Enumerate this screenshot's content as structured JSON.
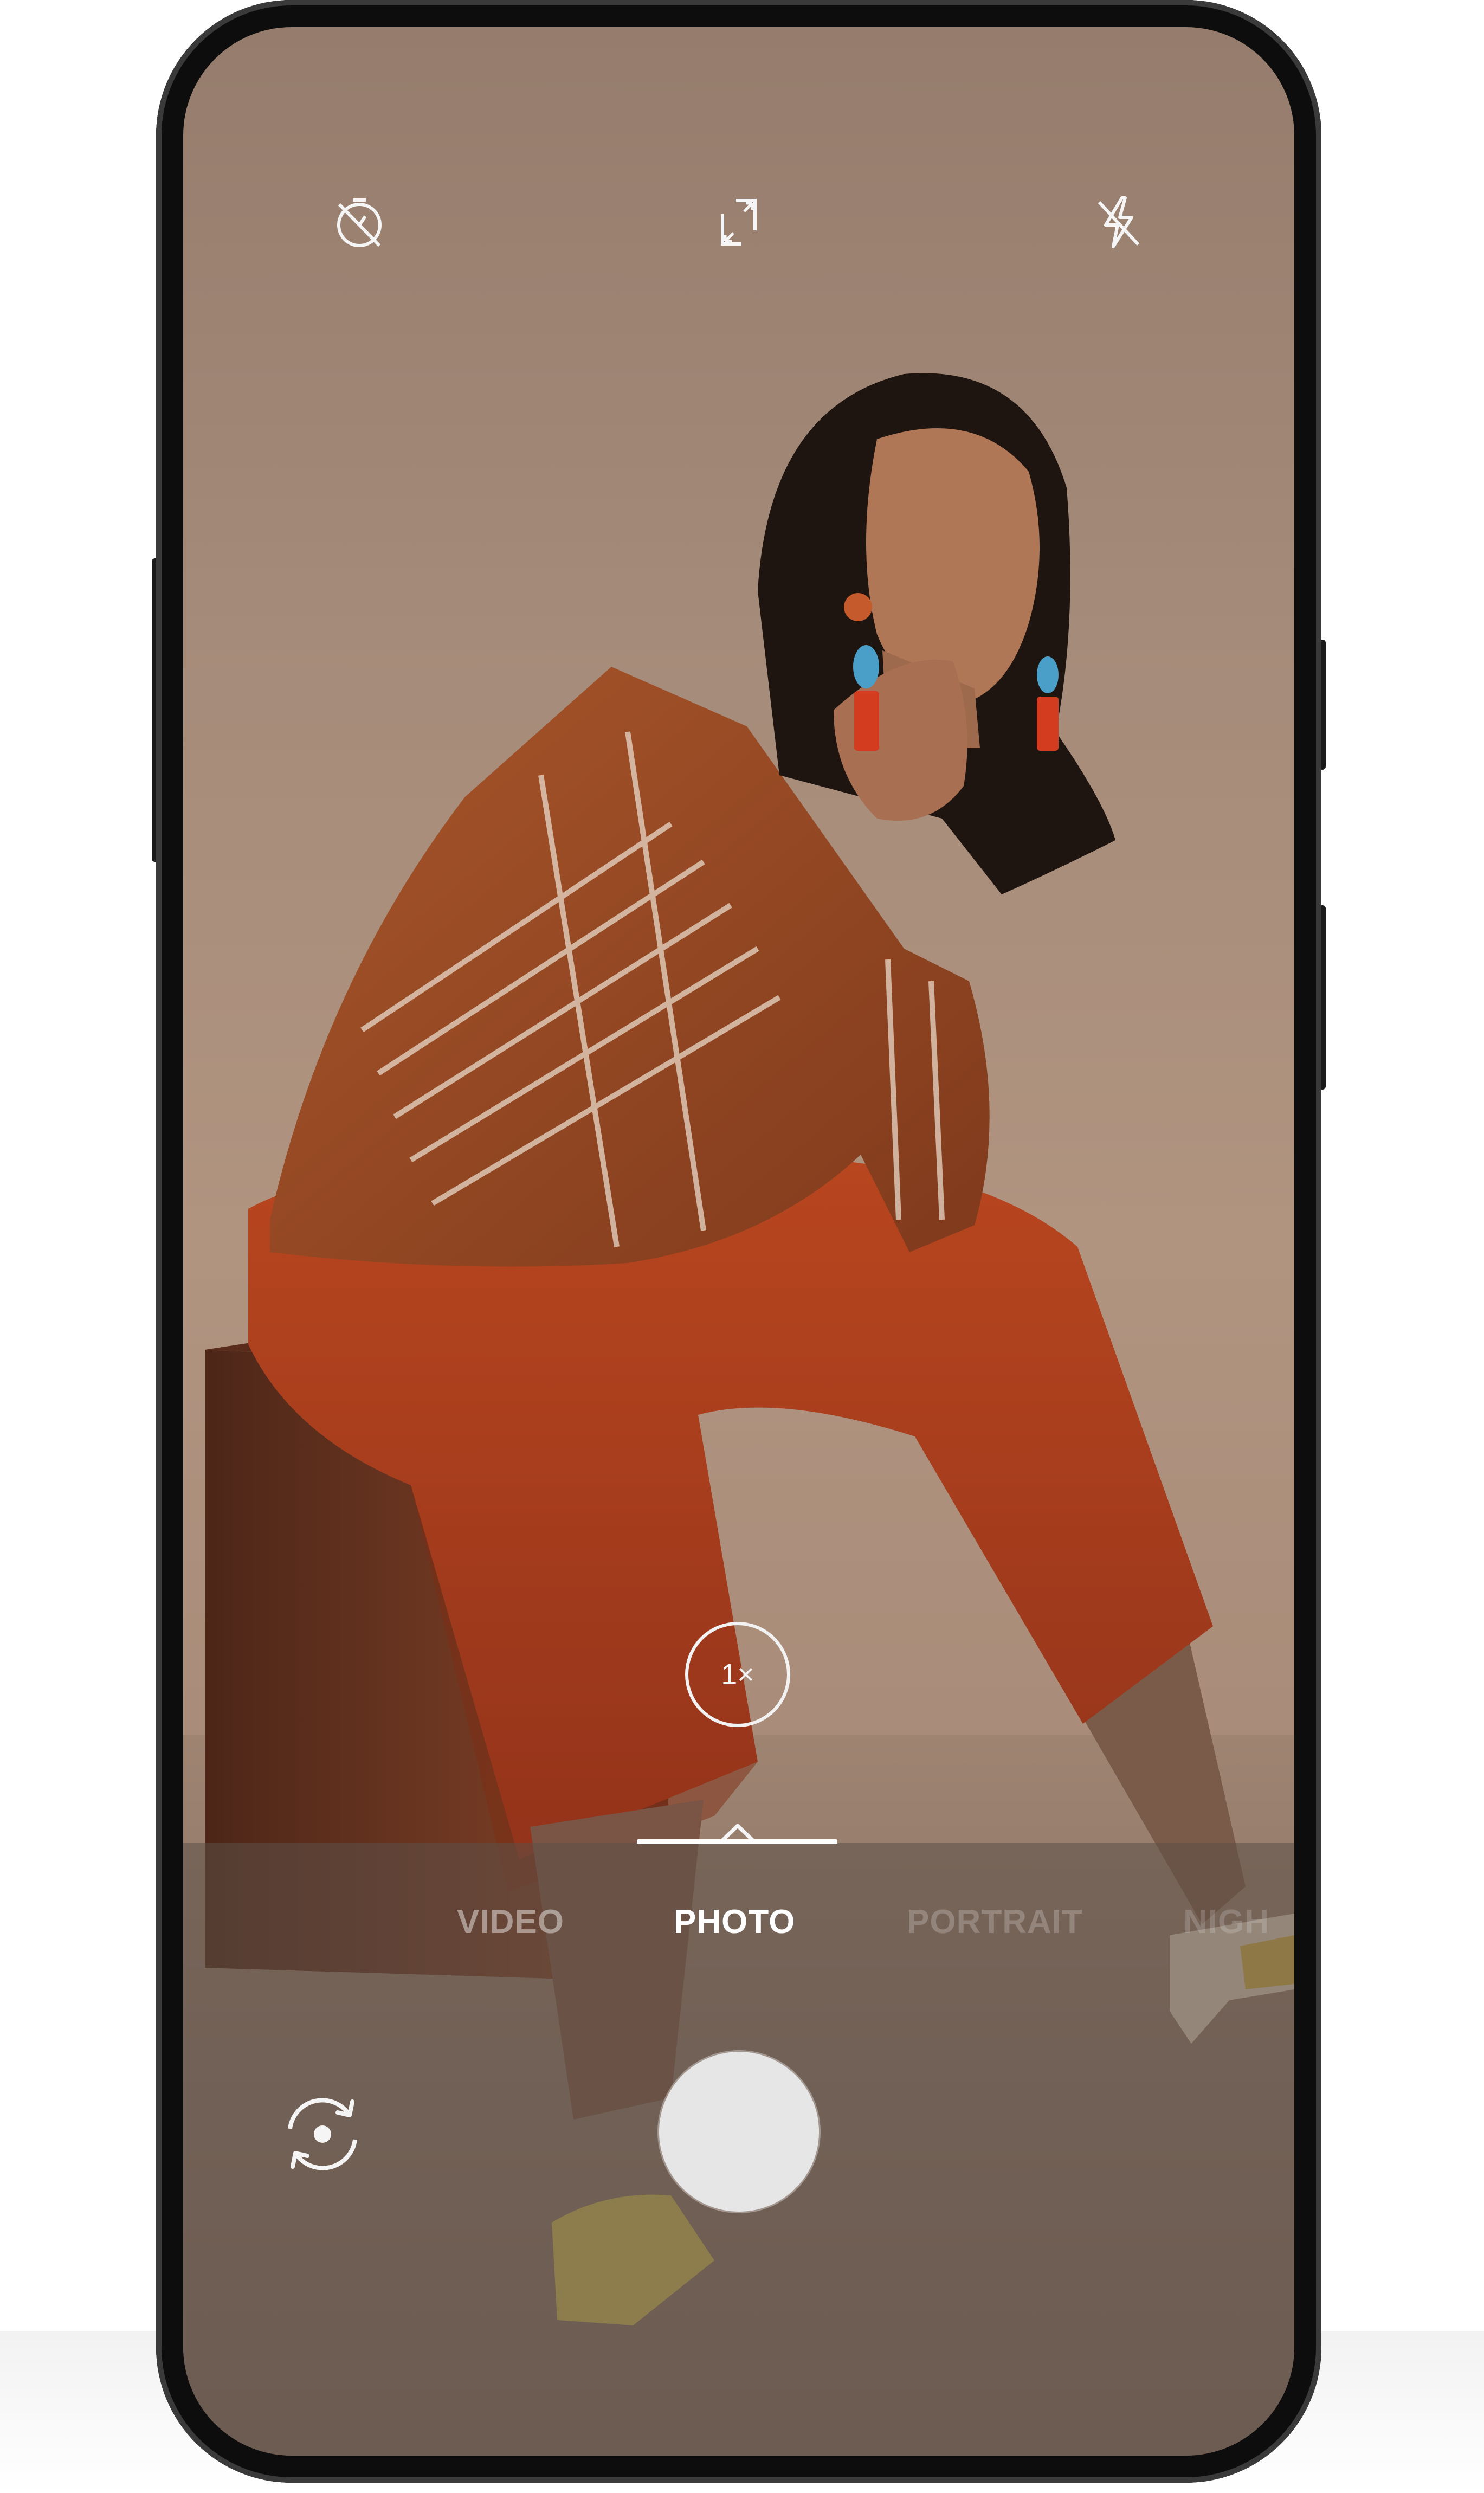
{
  "camera": {
    "top_bar": {
      "timer_icon": "timer-off-icon",
      "aspect_icon": "aspect-ratio-expand-icon",
      "flash_icon": "flash-off-icon"
    },
    "zoom": {
      "label": "1×"
    },
    "modes": {
      "items": [
        {
          "label": "VIDEO"
        },
        {
          "label": "PHOTO"
        },
        {
          "label": "PORTRAIT"
        },
        {
          "label": "NIGH"
        }
      ],
      "selected": "PHOTO"
    },
    "bottom_bar": {
      "switch_camera_icon": "switch-camera-icon",
      "shutter_icon": "shutter-button"
    }
  },
  "colors": {
    "background": "#a58b79",
    "shirt": "#9a4a22",
    "pants": "#b0401e",
    "stool": "#6e3522",
    "shutter": "#e6e6e6",
    "ui_white": "#ffffff"
  }
}
